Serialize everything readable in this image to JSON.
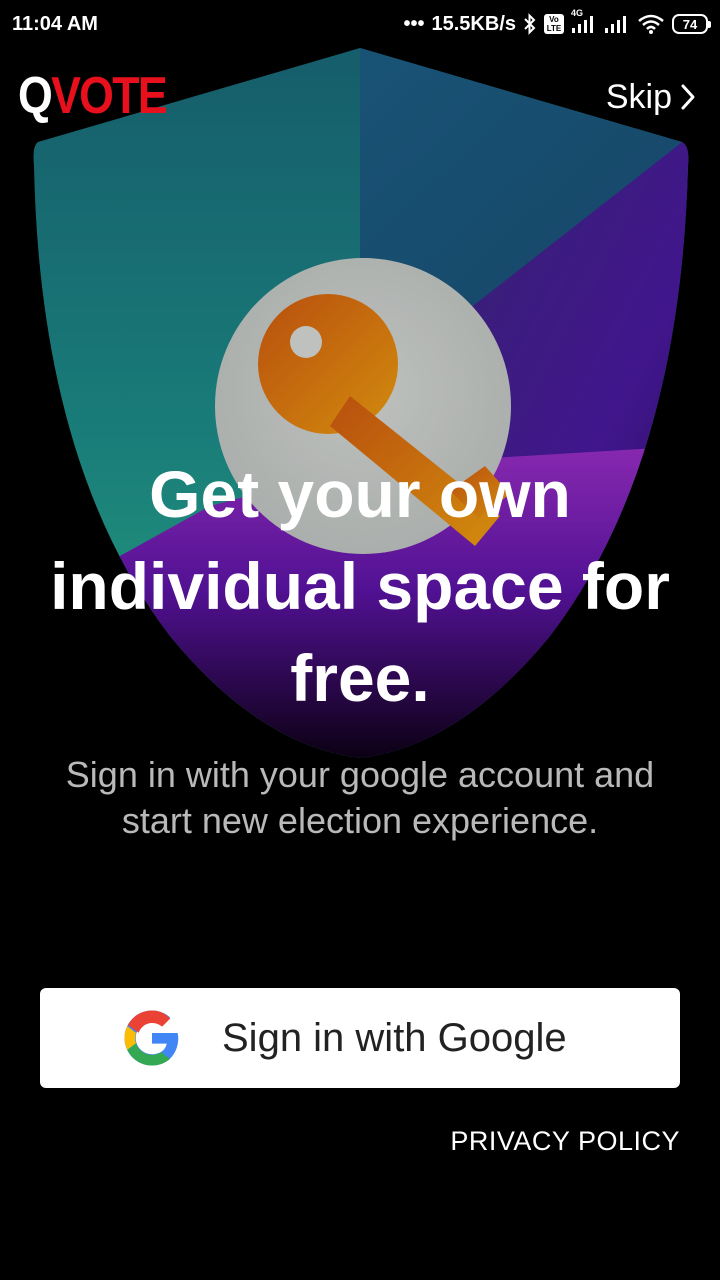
{
  "status_bar": {
    "time": "11:04 AM",
    "dots": "•••",
    "net_speed": "15.5KB/s",
    "volte_top": "Vo",
    "volte_bottom": "LTE",
    "network_type": "4G",
    "battery": "74",
    "icons": [
      "bluetooth-icon",
      "volte-icon",
      "signal-icon",
      "signal-icon",
      "wifi-icon",
      "battery-icon"
    ]
  },
  "header": {
    "logo_q": "Q",
    "logo_rest": "VOTE",
    "skip_label": "Skip"
  },
  "hero": {
    "headline": "Get your own individual space for free.",
    "subtext": "Sign in with your google account and start new election experience."
  },
  "google_button": {
    "label": "Sign in with Google"
  },
  "footer": {
    "privacy_label": "PRIVACY POLICY"
  },
  "colors": {
    "background": "#000000",
    "brand_red": "#e8101c",
    "button_bg": "#ffffff"
  }
}
